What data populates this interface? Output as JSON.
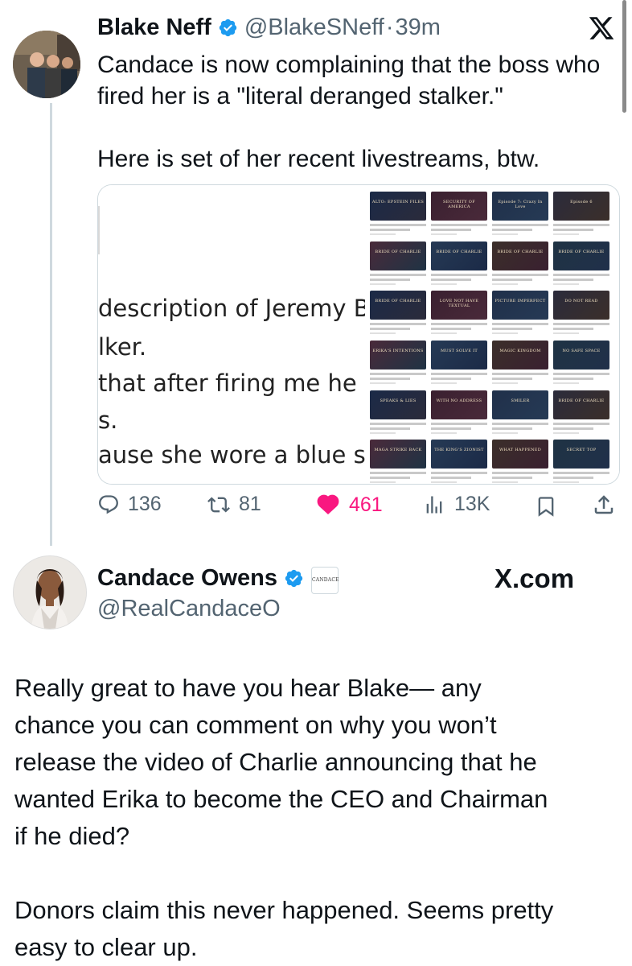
{
  "tweet1": {
    "author_name": "Blake Neff",
    "author_handle": "@BlakeSNeff",
    "separator": "·",
    "time": "39m",
    "text": "Candace is now complaining that the boss who\nfired her is a \"literal deranged stalker.\"\n\nHere is set of her recent livestreams, btw.",
    "media": {
      "doc_lines": [
        "description of Jeremy B",
        "lker.",
        "that after firing me he",
        "s.",
        "ause she wore a blue s"
      ],
      "thumb_titles": [
        "ALTO: EPSTEIN FILES",
        "SECURITY OF AMERICA",
        "Episode 7: Crazy In Love",
        "Episode 6",
        "BRIDE OF CHARLIE",
        "BRIDE OF CHARLIE",
        "BRIDE OF CHARLIE",
        "BRIDE OF CHARLIE",
        "BRIDE OF CHARLIE",
        "LOVE NOT HAVE TEXTUAL",
        "PICTURE IMPERFECT",
        "DO NOT READ",
        "ERIKA'S INTENTIONS",
        "MUST SOLVE IT",
        "MAGIC KINGDOM",
        "NO SAFE SPACE",
        "SPEAKS & LIES",
        "WITH NO ADDRESS",
        "SMILER",
        "BRIDE OF CHARLIE",
        "MAGA STRIKE BACK",
        "THE KING'S ZIONIST",
        "WHAT HAPPENED",
        "SECRET TOP"
      ]
    },
    "actions": {
      "replies": "136",
      "reposts": "81",
      "likes": "461",
      "views": "13K"
    }
  },
  "tweet2": {
    "author_name": "Candace Owens",
    "author_handle": "@RealCandaceO",
    "badge_text": "CANDACE",
    "brand": "X.com",
    "text": "Really great to have you hear Blake— any\nchance you can comment on why you won’t\nrelease the video of Charlie announcing that he\nwanted Erika to become the CEO and Chairman\nif he died?\n\nDonors claim this never happened. Seems pretty\neasy to clear up."
  },
  "colors": {
    "verified_blue": "#1d9bf0",
    "like_pink": "#f91880",
    "secondary_text": "#536471",
    "primary_text": "#0f1419"
  },
  "icons": [
    "verified-icon",
    "x-logo-icon",
    "reply-icon",
    "repost-icon",
    "like-icon",
    "views-icon",
    "bookmark-icon",
    "share-icon"
  ]
}
